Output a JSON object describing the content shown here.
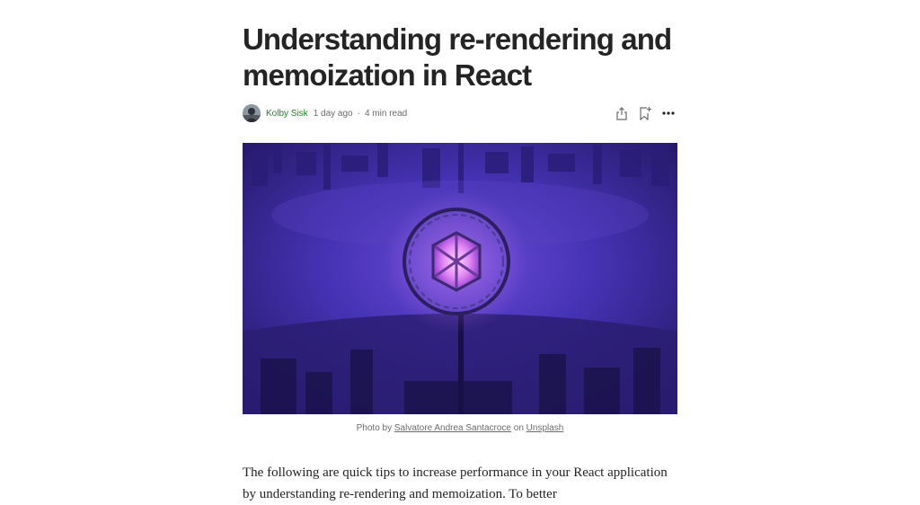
{
  "article": {
    "title": "Understanding re-rendering and memoization in React",
    "author": "Kolby Sisk",
    "published": "1 day ago",
    "separator": "·",
    "read_time": "4 min read",
    "actions": {
      "share_icon": "share-icon",
      "bookmark_icon": "bookmark-add-icon",
      "more_icon": "more-options-icon"
    },
    "caption": {
      "prefix": "Photo by",
      "photographer": "Salvatore Andrea Santacroce",
      "middle": "on",
      "source": "Unsplash"
    },
    "intro_text": "The following are quick tips to increase performance in your React application by understanding re-rendering and memoization. To better"
  },
  "colors": {
    "author_link": "#1a8917",
    "text": "#242424",
    "muted": "#6b6b6b",
    "hero_purple": "#3b2a8f"
  }
}
